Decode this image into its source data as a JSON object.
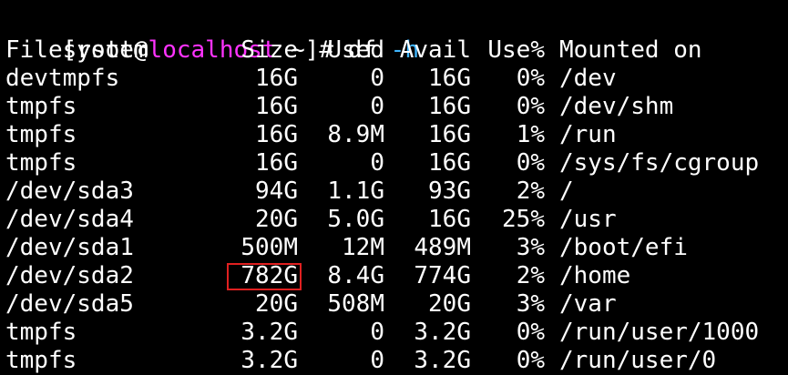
{
  "prompt": {
    "open": "[root@",
    "host": "localhost",
    "rest": " ~]# df ",
    "flag": "-h",
    "host_color": "#ff33ff",
    "flag_color": "#3fb6ff"
  },
  "headers": {
    "filesystem": "Filesystem",
    "size": "Size",
    "used": "Used",
    "avail": "Avail",
    "use_pct": "Use%",
    "mounted": "Mounted on"
  },
  "rows": [
    {
      "filesystem": "devtmpfs",
      "size": "16G",
      "used": "0",
      "avail": "16G",
      "use_pct": "0%",
      "mounted": "/dev"
    },
    {
      "filesystem": "tmpfs",
      "size": "16G",
      "used": "0",
      "avail": "16G",
      "use_pct": "0%",
      "mounted": "/dev/shm"
    },
    {
      "filesystem": "tmpfs",
      "size": "16G",
      "used": "8.9M",
      "avail": "16G",
      "use_pct": "1%",
      "mounted": "/run"
    },
    {
      "filesystem": "tmpfs",
      "size": "16G",
      "used": "0",
      "avail": "16G",
      "use_pct": "0%",
      "mounted": "/sys/fs/cgroup"
    },
    {
      "filesystem": "/dev/sda3",
      "size": "94G",
      "used": "1.1G",
      "avail": "93G",
      "use_pct": "2%",
      "mounted": "/"
    },
    {
      "filesystem": "/dev/sda4",
      "size": "20G",
      "used": "5.0G",
      "avail": "16G",
      "use_pct": "25%",
      "mounted": "/usr"
    },
    {
      "filesystem": "/dev/sda1",
      "size": "500M",
      "used": "12M",
      "avail": "489M",
      "use_pct": "3%",
      "mounted": "/boot/efi"
    },
    {
      "filesystem": "/dev/sda2",
      "size": "782G",
      "used": "8.4G",
      "avail": "774G",
      "use_pct": "2%",
      "mounted": "/home"
    },
    {
      "filesystem": "/dev/sda5",
      "size": "20G",
      "used": "508M",
      "avail": "20G",
      "use_pct": "3%",
      "mounted": "/var"
    },
    {
      "filesystem": "tmpfs",
      "size": "3.2G",
      "used": "0",
      "avail": "3.2G",
      "use_pct": "0%",
      "mounted": "/run/user/1000"
    },
    {
      "filesystem": "tmpfs",
      "size": "3.2G",
      "used": "0",
      "avail": "3.2G",
      "use_pct": "0%",
      "mounted": "/run/user/0"
    }
  ],
  "highlight": {
    "color": "#e02020"
  }
}
